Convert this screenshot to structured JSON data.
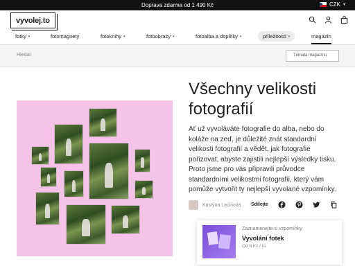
{
  "topbar": {
    "promo": "Doprava zdarma od 1 490 Kč",
    "currency": "CZK",
    "caret": "▾"
  },
  "header": {
    "logo": "vyvolej.to",
    "icons": [
      "search-icon",
      "user-icon",
      "bag-icon"
    ]
  },
  "nav": {
    "items": [
      {
        "label": "fotky",
        "caret": "▾"
      },
      {
        "label": "fotomagnety",
        "caret": ""
      },
      {
        "label": "fotoknihy",
        "caret": "▾"
      },
      {
        "label": "fotoobrazy",
        "caret": "▾"
      },
      {
        "label": "fotoalba a doplňky",
        "caret": "▾"
      },
      {
        "label": "příležitosti",
        "caret": "▾"
      },
      {
        "label": "magazín",
        "caret": ""
      }
    ]
  },
  "subbar": {
    "search_label": "Hledat",
    "search_placeholder": "Hledat",
    "topics_label": "Témata magazínu"
  },
  "article": {
    "title": "Všechny velikosti fotografií",
    "description": "Ať už vyvoláváte fotografie do alba, nebo do koláže na zeď, je důležité znát standardní velikosti fotografií a vědět, jak fotografie pořizovat, abyste zajistili nejlepší výsledky tisku. Proto jsme pro vás připravili průvodce standardními velikostmi fotografií, který vám pomůže vytvořit ty nejlepší vyvolané vzpomínky.",
    "author": "Kristýna Lacinová",
    "share_label": "Sdílejte",
    "share_icons": [
      "facebook-icon",
      "pinterest-icon",
      "twitter-icon",
      "copy-link-icon"
    ]
  },
  "promo_card": {
    "subtitle": "Zaznamenejte si vzpomínky",
    "title": "Vyvolání fotek",
    "price": "Od 6 Kč / ks"
  },
  "colors": {
    "hero_bg": "#f5c3e8",
    "topbar_bg": "#111111"
  }
}
